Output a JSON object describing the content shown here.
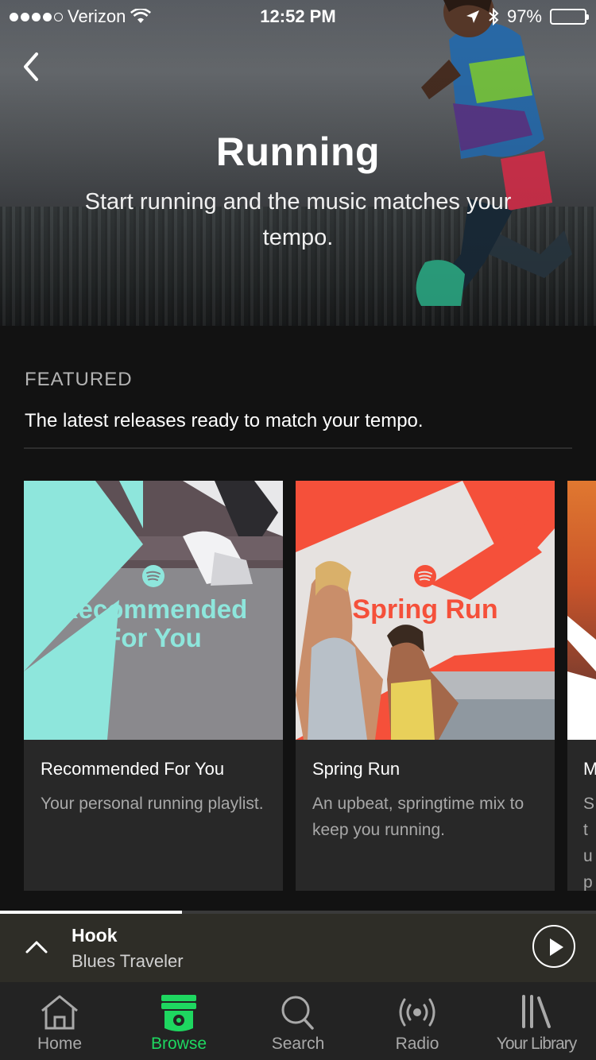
{
  "status_bar": {
    "carrier": "Verizon",
    "time": "12:52 PM",
    "battery": "97%",
    "battery_level": 0.97
  },
  "hero": {
    "title": "Running",
    "subtitle": "Start running and the music matches your tempo."
  },
  "featured": {
    "label": "FEATURED",
    "description": "The latest releases ready to match your tempo.",
    "cards": [
      {
        "art_text": "Recommended For You",
        "title": "Recommended For You",
        "description": "Your personal running playlist."
      },
      {
        "art_text": "Spring Run",
        "title": "Spring Run",
        "description": "An upbeat, springtime mix to keep you running."
      },
      {
        "title": "M",
        "description": "St up"
      }
    ]
  },
  "now_playing": {
    "title": "Hook",
    "artist": "Blues Traveler",
    "progress": 0.305
  },
  "tabs": [
    {
      "label": "Home",
      "icon": "home-icon",
      "active": false
    },
    {
      "label": "Browse",
      "icon": "browse-icon",
      "active": true
    },
    {
      "label": "Search",
      "icon": "search-icon",
      "active": false
    },
    {
      "label": "Radio",
      "icon": "radio-icon",
      "active": false
    },
    {
      "label": "Your Library",
      "icon": "library-icon",
      "active": false
    }
  ],
  "colors": {
    "accent": "#1ed760",
    "background": "#121212",
    "card": "#282828",
    "recommended_teal": "#8ee6dc",
    "spring_red": "#f5503a"
  }
}
